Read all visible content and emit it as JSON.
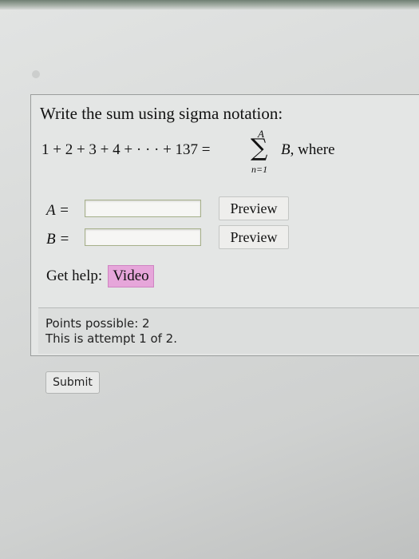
{
  "question": {
    "prompt": "Write the sum using sigma notation:",
    "equation": {
      "lhs": "1 + 2 + 3 + 4 + · · · + 137 =",
      "sigma_symbol": "∑",
      "upper_limit": "A",
      "lower_limit": "n=1",
      "summand": "B",
      "trailing": ", where"
    }
  },
  "answers": [
    {
      "label": "A =",
      "value": "",
      "preview_label": "Preview"
    },
    {
      "label": "B =",
      "value": "",
      "preview_label": "Preview"
    }
  ],
  "help": {
    "label": "Get help:",
    "video_label": "Video"
  },
  "info": {
    "points": "Points possible: 2",
    "attempt": "This is attempt 1 of 2."
  },
  "submit_label": "Submit",
  "colors": {
    "video_button_bg": "#e6a6da",
    "input_border": "#a6b08a"
  }
}
